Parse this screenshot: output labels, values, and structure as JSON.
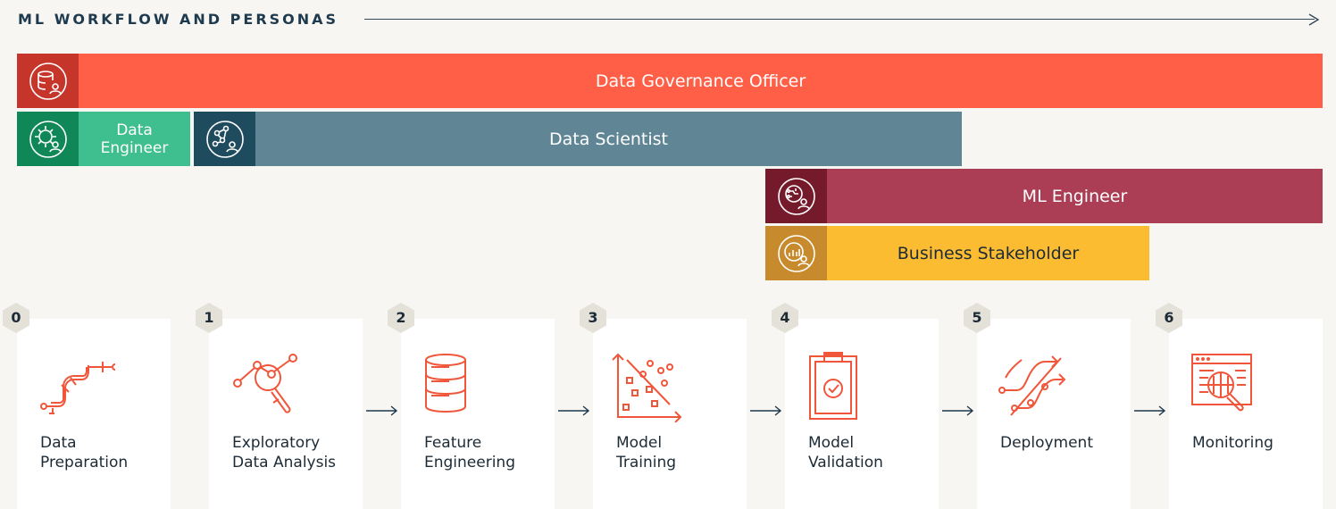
{
  "title": "ML WORKFLOW AND PERSONAS",
  "colors": {
    "governance": "#ff5f46",
    "governance_icon": "#c6352a",
    "engineer": "#3fbf90",
    "engineer_icon": "#0f8757",
    "scientist": "#608696",
    "scientist_icon": "#1f4b5e",
    "ml": "#ab3e55",
    "ml_icon": "#751a2a",
    "business": "#fbbc32",
    "business_icon": "#c78a2c",
    "step_icon": "#f0563a"
  },
  "personas": [
    {
      "label": "Data Governance Officer",
      "icon": "database-user-icon"
    },
    {
      "label": "Data\nEngineer",
      "icon": "gear-user-icon"
    },
    {
      "label": "Data Scientist",
      "icon": "network-user-icon"
    },
    {
      "label": "ML Engineer",
      "icon": "circuit-user-icon"
    },
    {
      "label": "Business Stakeholder",
      "icon": "chart-user-icon"
    }
  ],
  "steps": [
    {
      "num": "0",
      "label": "Data\nPreparation",
      "icon": "pipeline-icon"
    },
    {
      "num": "1",
      "label": "Exploratory\nData Analysis",
      "icon": "magnifier-graph-icon"
    },
    {
      "num": "2",
      "label": "Feature\nEngineering",
      "icon": "database-icon"
    },
    {
      "num": "3",
      "label": "Model\nTraining",
      "icon": "scatter-plot-icon"
    },
    {
      "num": "4",
      "label": "Model\nValidation",
      "icon": "clipboard-check-icon"
    },
    {
      "num": "5",
      "label": "Deployment",
      "icon": "deploy-arrows-icon"
    },
    {
      "num": "6",
      "label": "Monitoring",
      "icon": "monitor-search-icon"
    }
  ]
}
